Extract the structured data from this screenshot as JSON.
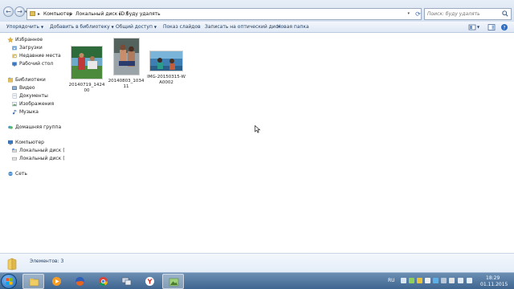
{
  "address_bar": {
    "crumbs": [
      "Компьютер",
      "Локальный диск (D:)",
      "буду удалять"
    ],
    "search_placeholder": "Поиск: буду удалять"
  },
  "toolbar": {
    "organize": "Упорядочить",
    "add_to_library": "Добавить в библиотеку",
    "share": "Общий доступ",
    "slideshow": "Показ слайдов",
    "burn": "Записать на оптический диск",
    "new_folder": "Новая папка"
  },
  "sidebar": {
    "favorites": {
      "label": "Избранное",
      "items": [
        "Загрузки",
        "Недавние места",
        "Рабочий стол"
      ]
    },
    "libraries": {
      "label": "Библиотеки",
      "items": [
        "Видео",
        "Документы",
        "Изображения",
        "Музыка"
      ]
    },
    "homegroup": "Домашняя группа",
    "computer": {
      "label": "Компьютер",
      "items": [
        "Локальный диск (C",
        "Локальный диск (D"
      ]
    },
    "network": "Сеть"
  },
  "files": [
    {
      "name": "20140719_142400"
    },
    {
      "name": "20140803_103411"
    },
    {
      "name": "IMG-20150315-WA0002"
    }
  ],
  "details": {
    "count_text": "Элементов: 3"
  },
  "taskbar": {
    "apps": [
      "explorer-icon",
      "media-player-icon",
      "firefox-icon",
      "chrome-icon",
      "network-pc-icon",
      "yandex-browser-icon",
      "image-viewer-icon"
    ]
  },
  "tray": {
    "language": "RU",
    "time": "18:29",
    "date": "01.11.2015"
  },
  "colors": {
    "taskbar": "#4a7099",
    "accent": "#1e3a5f"
  }
}
